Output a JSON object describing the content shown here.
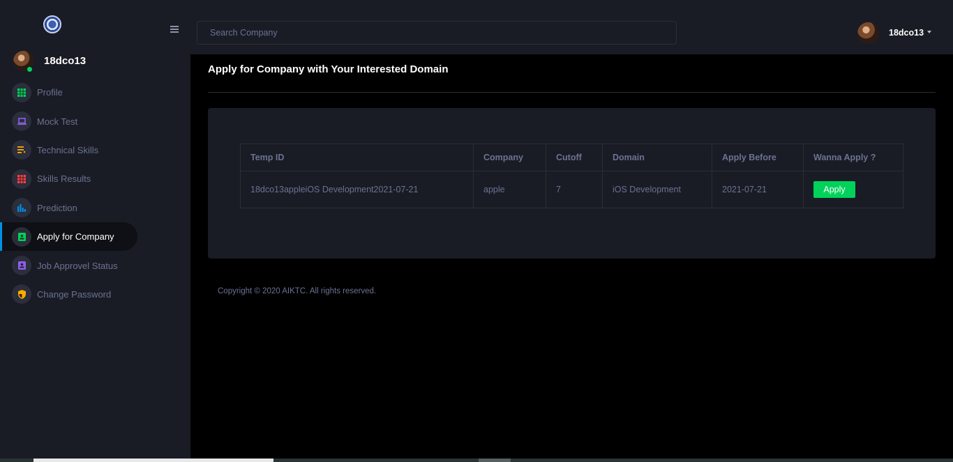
{
  "sidebar": {
    "profile_name": "18dco13",
    "items": [
      {
        "label": "Profile",
        "icon": "grid-icon",
        "color": "#00d25b"
      },
      {
        "label": "Mock Test",
        "icon": "laptop-icon",
        "color": "#8f5fe8"
      },
      {
        "label": "Technical Skills",
        "icon": "playlist-icon",
        "color": "#ffab00"
      },
      {
        "label": "Skills Results",
        "icon": "table-icon",
        "color": "#fc424a"
      },
      {
        "label": "Prediction",
        "icon": "chart-bar-icon",
        "color": "#0090e7"
      },
      {
        "label": "Apply for Company",
        "icon": "contacts-icon",
        "color": "#00d25b",
        "active": true
      },
      {
        "label": "Job Approvel Status",
        "icon": "contacts-icon",
        "color": "#8f5fe8"
      },
      {
        "label": "Change Password",
        "icon": "security-icon",
        "color": "#ffab00"
      }
    ]
  },
  "topbar": {
    "search_placeholder": "Search Company",
    "user_name": "18dco13"
  },
  "main": {
    "title": "Apply for Company with Your Interested Domain",
    "table": {
      "headers": [
        "Temp ID",
        "Company",
        "Cutoff",
        "Domain",
        "Apply Before",
        "Wanna Apply ?"
      ],
      "rows": [
        {
          "temp_id": "18dco13appleiOS Development2021-07-21",
          "company": "apple",
          "cutoff": "7",
          "domain": "iOS Development",
          "apply_before": "2021-07-21",
          "action": "Apply"
        }
      ]
    }
  },
  "footer": {
    "copyright": "Copyright © 2020 AIKTC. All rights reserved."
  },
  "colors": {
    "accent_green": "#00d25b",
    "accent_blue": "#0090e7",
    "panel_bg": "#191c24",
    "muted_text": "#6c7293"
  }
}
